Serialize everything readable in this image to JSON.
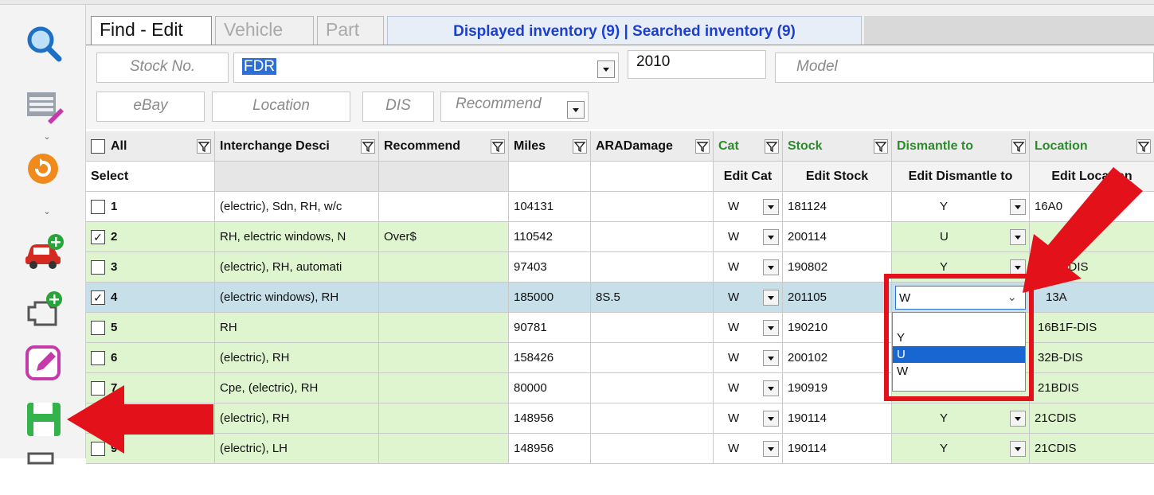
{
  "tabs": {
    "find_edit": "Find - Edit",
    "vehicle": "Vehicle",
    "part": "Part",
    "inventory_info": "Displayed inventory (9) | Searched inventory (9)"
  },
  "filters": {
    "stock_no_placeholder": "Stock No.",
    "make_value": "FDR",
    "year_value": "2010",
    "model_placeholder": "Model",
    "ebay_placeholder": "eBay",
    "location_placeholder": "Location",
    "dis_placeholder": "DIS",
    "recommend_placeholder": "Recommend"
  },
  "headers": {
    "all": "All",
    "interchange": "Interchange Desci",
    "recommend": "Recommend",
    "miles": "Miles",
    "aradamage": "ARADamage",
    "cat": "Cat",
    "stock": "Stock",
    "dismantle": "Dismantle to",
    "location": "Location"
  },
  "subheaders": {
    "select": "Select",
    "edit_cat": "Edit Cat",
    "edit_stock": "Edit Stock",
    "edit_dismantle": "Edit Dismantle to",
    "edit_location": "Edit Location"
  },
  "rows": [
    {
      "num": "1",
      "checked": "",
      "interchange": "(electric), Sdn, RH, w/c",
      "recommend": "",
      "miles": "104131",
      "damage": "",
      "cat": "W",
      "stock": "181124",
      "dismantle": "Y",
      "location": "16A0"
    },
    {
      "num": "2",
      "checked": "✓",
      "interchange": "RH, electric windows, N",
      "recommend": "Over$",
      "miles": "110542",
      "damage": "",
      "cat": "W",
      "stock": "200114",
      "dismantle": "U",
      "location": "-DIS"
    },
    {
      "num": "3",
      "checked": "",
      "interchange": "(electric), RH, automati",
      "recommend": "",
      "miles": "97403",
      "damage": "",
      "cat": "W",
      "stock": "190802",
      "dismantle": "Y",
      "location": "2F-DIS"
    },
    {
      "num": "4",
      "checked": "✓",
      "interchange": "(electric windows), RH",
      "recommend": "",
      "miles": "185000",
      "damage": "8S.5",
      "cat": "W",
      "stock": "201105",
      "dismantle": "W",
      "location": "13A"
    },
    {
      "num": "5",
      "checked": "",
      "interchange": "RH",
      "recommend": "",
      "miles": "90781",
      "damage": "",
      "cat": "W",
      "stock": "190210",
      "dismantle": "",
      "location": "16B1F-DIS"
    },
    {
      "num": "6",
      "checked": "",
      "interchange": "(electric), RH",
      "recommend": "",
      "miles": "158426",
      "damage": "",
      "cat": "W",
      "stock": "200102",
      "dismantle": "",
      "location": "32B-DIS"
    },
    {
      "num": "7",
      "checked": "",
      "interchange": "Cpe, (electric), RH",
      "recommend": "",
      "miles": "80000",
      "damage": "",
      "cat": "W",
      "stock": "190919",
      "dismantle": "",
      "location": "21BDIS"
    },
    {
      "num": "8",
      "checked": "",
      "interchange": "(electric), RH",
      "recommend": "",
      "miles": "148956",
      "damage": "",
      "cat": "W",
      "stock": "190114",
      "dismantle": "Y",
      "location": "21CDIS"
    },
    {
      "num": "9",
      "checked": "",
      "interchange": "(electric), LH",
      "recommend": "",
      "miles": "148956",
      "damage": "",
      "cat": "W",
      "stock": "190114",
      "dismantle": "Y",
      "location": "21CDIS"
    }
  ],
  "dropdown_options": [
    "",
    "Y",
    "U",
    "W"
  ],
  "colors": {
    "row_green": "#dff5cf",
    "row_selected": "#c7dfe9",
    "accent_blue": "#1766d1",
    "annotation_red": "#e3111a",
    "header_green_text": "#2d8a2d"
  },
  "icons": [
    "search-icon",
    "edit-list-icon",
    "refresh-icon",
    "add-vehicle-icon",
    "add-part-icon",
    "edit-icon",
    "save-icon",
    "export-icon"
  ]
}
